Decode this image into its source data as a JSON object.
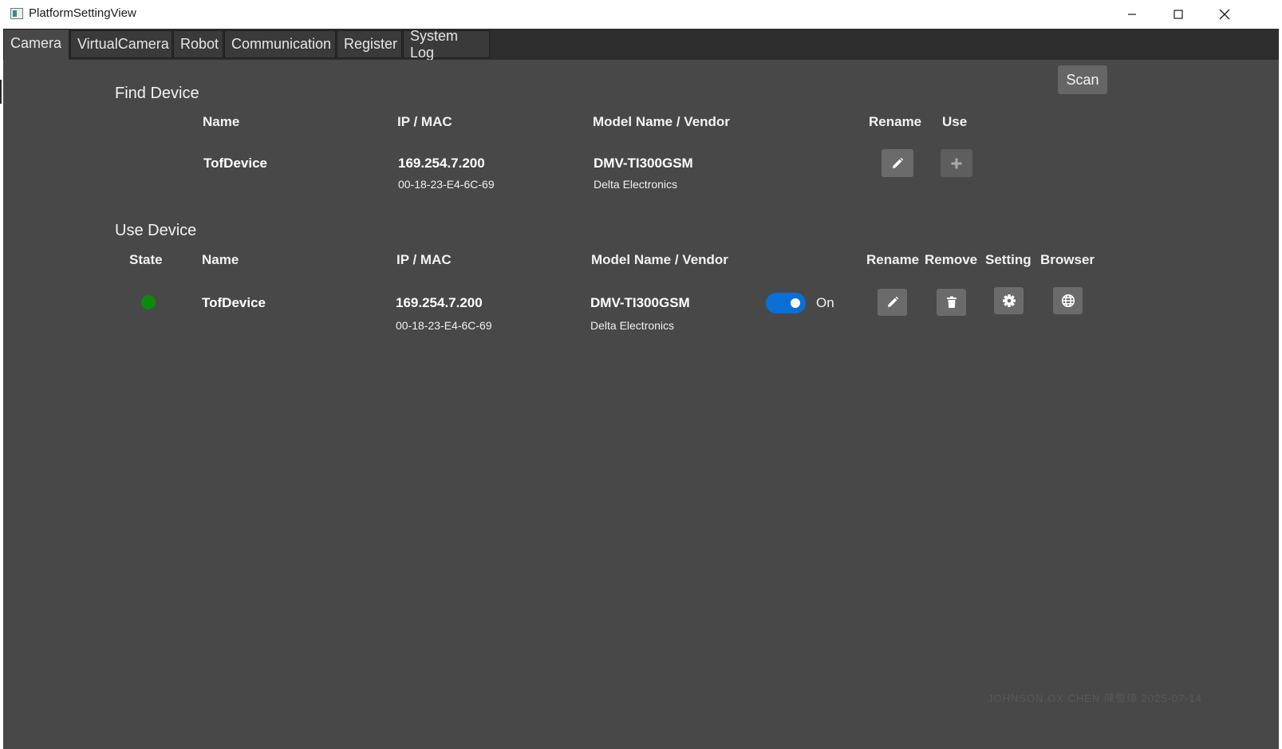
{
  "window": {
    "title": "PlatformSettingView"
  },
  "tabs": [
    {
      "label": "Camera",
      "active": true
    },
    {
      "label": "VirtualCamera",
      "active": false
    },
    {
      "label": "Robot",
      "active": false
    },
    {
      "label": "Communication",
      "active": false
    },
    {
      "label": "Register",
      "active": false
    },
    {
      "label": "System Log",
      "active": false
    }
  ],
  "scan_label": "Scan",
  "find_device": {
    "title": "Find Device",
    "headers": {
      "name": "Name",
      "ip_mac": "IP / MAC",
      "model_vendor": "Model Name / Vendor",
      "rename": "Rename",
      "use": "Use"
    },
    "row": {
      "name": "TofDevice",
      "ip": "169.254.7.200",
      "mac": "00-18-23-E4-6C-69",
      "model": "DMV-TI300GSM",
      "vendor": "Delta Electronics",
      "icons": {
        "rename": "pencil-icon",
        "use": "plus-icon"
      }
    }
  },
  "use_device": {
    "title": "Use Device",
    "headers": {
      "state": "State",
      "name": "Name",
      "ip_mac": "IP / MAC",
      "model_vendor": "Model Name / Vendor",
      "rename": "Rename",
      "remove": "Remove",
      "setting": "Setting",
      "browser": "Browser"
    },
    "row": {
      "state_color": "#0c8a0c",
      "name": "TofDevice",
      "ip": "169.254.7.200",
      "mac": "00-18-23-E4-6C-69",
      "model": "DMV-TI300GSM",
      "vendor": "Delta Electronics",
      "toggle_on": true,
      "toggle_label": "On",
      "icons": {
        "rename": "pencil-icon",
        "remove": "trash-icon",
        "setting": "gear-icon",
        "browser": "globe-icon"
      }
    }
  },
  "watermark": "JOHNSON.OX.CHEN 陳俊璋 2025-07-14",
  "colors": {
    "background": "#484848",
    "tabbar": "#2d2d2d",
    "accent": "#0a6fd6",
    "state_ok": "#0c8a0c"
  }
}
